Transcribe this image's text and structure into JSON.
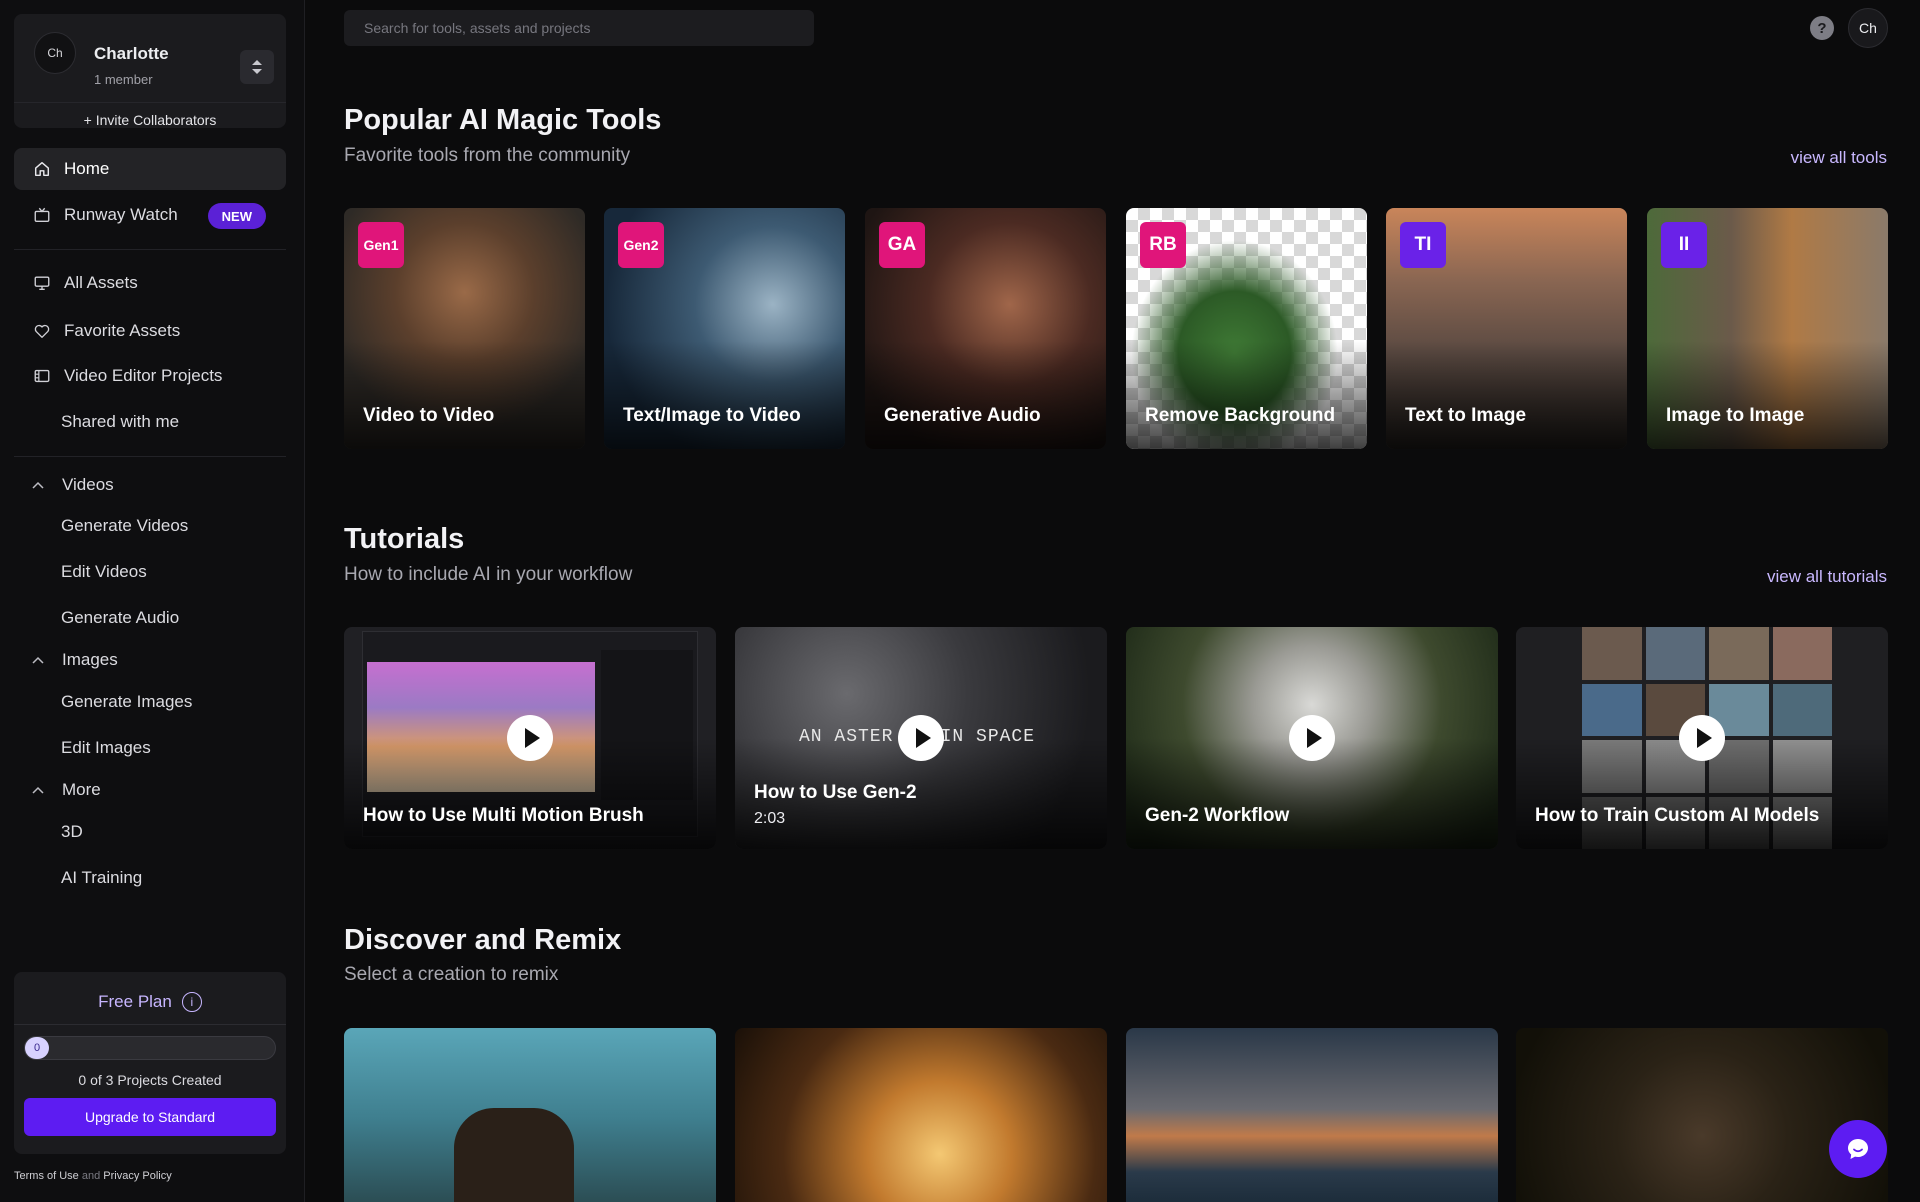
{
  "workspace": {
    "avatar_initials": "Ch",
    "name": "Charlotte",
    "members": "1 member",
    "invite_label": "+ Invite Collaborators"
  },
  "nav": {
    "home": "Home",
    "runway_watch": "Runway Watch",
    "new_badge": "NEW",
    "all_assets": "All Assets",
    "favorite_assets": "Favorite Assets",
    "video_editor_projects": "Video Editor Projects",
    "shared_with_me": "Shared with me"
  },
  "groups": {
    "videos": {
      "label": "Videos",
      "items": [
        "Generate Videos",
        "Edit Videos",
        "Generate Audio"
      ]
    },
    "images": {
      "label": "Images",
      "items": [
        "Generate Images",
        "Edit Images"
      ]
    },
    "more": {
      "label": "More",
      "items": [
        "3D",
        "AI Training"
      ]
    }
  },
  "plan": {
    "title": "Free Plan",
    "info_icon": "i",
    "progress_value": "0",
    "progress_fraction": 0,
    "count_text": "0 of 3 Projects Created",
    "upgrade_label": "Upgrade to Standard"
  },
  "legal": {
    "terms": "Terms of Use",
    "and": "and",
    "privacy": "Privacy Policy"
  },
  "header": {
    "search_placeholder": "Search for tools, assets and projects",
    "help_icon": "?",
    "user_initials": "Ch"
  },
  "tools_section": {
    "title": "Popular AI Magic Tools",
    "subtitle": "Favorite tools from the community",
    "view_all": "view all tools",
    "items": [
      {
        "badge": "Gen1",
        "label": "Video to Video"
      },
      {
        "badge": "Gen2",
        "label": "Text/Image to Video"
      },
      {
        "badge": "GA",
        "label": "Generative Audio"
      },
      {
        "badge": "RB",
        "label": "Remove Background"
      },
      {
        "badge": "TI",
        "label": "Text to Image"
      },
      {
        "badge": "II",
        "label": "Image to Image"
      }
    ]
  },
  "tutorials_section": {
    "title": "Tutorials",
    "subtitle": "How to include AI in your workflow",
    "view_all": "view all tutorials",
    "items": [
      {
        "label": "How to Use Multi Motion Brush"
      },
      {
        "label": "How to Use Gen-2",
        "duration": "2:03",
        "overlay_text": "AN ASTER    IN SPACE"
      },
      {
        "label": "Gen-2 Workflow"
      },
      {
        "label": "How to Train Custom AI Models"
      }
    ]
  },
  "discover_section": {
    "title": "Discover and Remix",
    "subtitle": "Select a creation to remix"
  },
  "colors": {
    "accent": "#5d1cf2",
    "badge_pink": "#e0157a",
    "badge_purple": "#6a22e8",
    "link": "#c9b8ff"
  }
}
